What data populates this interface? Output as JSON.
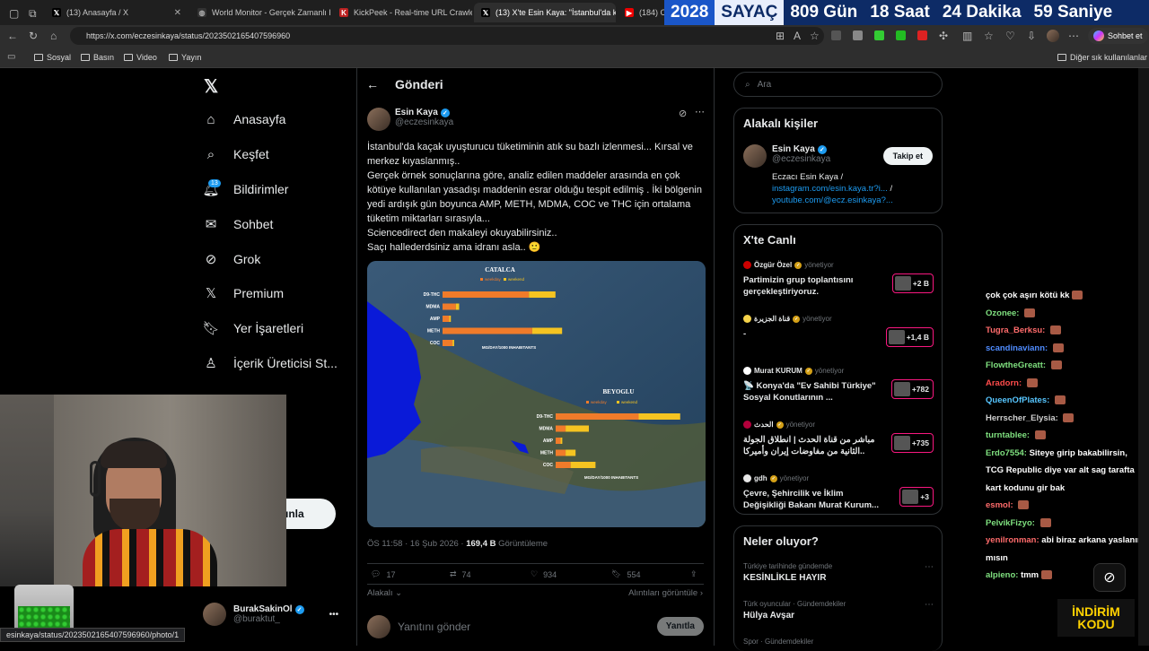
{
  "browser": {
    "tabs": [
      {
        "title": "(13) Anasayfa / X",
        "icon": "x-logo-icon"
      },
      {
        "title": "World Monitor - Gerçek Zamanlı K",
        "icon": "globe-icon"
      },
      {
        "title": "KickPeek - Real-time URL Crawler",
        "icon": "kickpeek-icon"
      },
      {
        "title": "(13) X'te Esin Kaya: \"İstanbul'da kaç",
        "icon": "x-logo-icon"
      },
      {
        "title": "(184) CH",
        "icon": "youtube-icon"
      }
    ],
    "active_tab": 3,
    "url": "https://x.com/eczesinkaya/status/2023502165407596960",
    "profile_button": "Sohbet et",
    "bookmarks": [
      "Sosyal",
      "Basın",
      "Video",
      "Yayın"
    ],
    "other_bookmarks": "Diğer sık kullanılanlar",
    "status_url": "esinkaya/status/2023502165407596960/photo/1"
  },
  "countdown": {
    "year": "2028",
    "label": "SAYAÇ",
    "days": "809 Gün",
    "hours": "18 Saat",
    "minutes": "24 Dakika",
    "seconds": "59 Saniye"
  },
  "sidebar": {
    "items": [
      {
        "label": "Anasayfa",
        "icon": "home-icon"
      },
      {
        "label": "Keşfet",
        "icon": "search-icon"
      },
      {
        "label": "Bildirimler",
        "icon": "bell-icon",
        "badge": "13"
      },
      {
        "label": "Sohbet",
        "icon": "mail-icon"
      },
      {
        "label": "Grok",
        "icon": "grok-icon"
      },
      {
        "label": "Premium",
        "icon": "x-premium-icon"
      },
      {
        "label": "Yer İşaretleri",
        "icon": "bookmark-icon"
      },
      {
        "label": "İçerik Üreticisi St...",
        "icon": "creator-icon"
      }
    ],
    "post_button_fragment": "ınla",
    "user": {
      "name": "BurakSakinOl",
      "handle": "@buraktut_"
    }
  },
  "post": {
    "header": "Gönderi",
    "author_name": "Esin Kaya",
    "author_handle": "@eczesinkaya",
    "text_lines": [
      "İstanbul'da kaçak uyuşturucu tüketiminin atık su bazlı izlenmesi... Kırsal ve merkez kıyaslanmış..",
      "Gerçek örnek sonuçlarına göre, analiz edilen maddeler arasında en çok kötüye kullanılan yasadışı maddenin esrar olduğu tespit edilmiş . İki bölgenin yedi ardışık gün boyunca AMP, METH, MDMA, COC ve THC için ortalama tüketim miktarları sırasıyla...",
      "Sciencedirect den makaleyi okuyabilirsiniz..",
      "Saçı hallederdsiniz ama idranı asla.. 🙂"
    ],
    "timestamp": "ÖS 11:58 · 16 Şub 2026 ·",
    "views": "169,4 B",
    "views_label": "Görüntüleme",
    "replies": "17",
    "reposts": "74",
    "likes": "934",
    "bookmarks": "554",
    "sort_label": "Alakalı",
    "quotes_label": "Alıntıları görüntüle",
    "reply_placeholder": "Yanıtını gönder",
    "reply_button": "Yanıtla"
  },
  "map_figure": {
    "region1": "CATALCA",
    "region2": "BEYOGLU",
    "legend_weekday": "weekday",
    "legend_weekend": "weekend",
    "unit_label": "MG/DAY/1000 INHABITANTS",
    "labels": [
      "D9-THC",
      "MDMA",
      "AMP",
      "METH",
      "COC"
    ],
    "region1_weekday": [
      52,
      8,
      4,
      54,
      6
    ],
    "region1_weekend": [
      68,
      10,
      5,
      72,
      7
    ],
    "region2_weekday": [
      50,
      6,
      3,
      6,
      9
    ],
    "region2_weekend": [
      75,
      20,
      4,
      12,
      24
    ]
  },
  "right": {
    "search_placeholder": "Ara",
    "related_title": "Alakalı kişiler",
    "related": {
      "name": "Esin Kaya",
      "handle": "@eczesinkaya",
      "follow": "Takip et",
      "bio1": "Eczacı Esin Kaya /",
      "link1": "instagram.com/esin.kaya.tr?i...",
      "sep": "/",
      "link2": "youtube.com/@ecz.esinkaya?..."
    },
    "live_title": "X'te Canlı",
    "live": [
      {
        "host": "Özgür Özel",
        "status": "yönetiyor",
        "title": "Partimizin grup toplantısını gerçekleştiriyoruz.",
        "count": "+2 B"
      },
      {
        "host": "قناة الجزيرة",
        "status": "yönetiyor",
        "title": "-",
        "count": "+1,4 B"
      },
      {
        "host": "Murat KURUM",
        "status": "yönetiyor",
        "title": "📡 Konya'da \"Ev Sahibi Türkiye\" Sosyal Konutlarının ...",
        "count": "+782"
      },
      {
        "host": "الحدث",
        "status": "yönetiyor",
        "title": "مباشر من قناة الحدث | انطلاق الجولة الثانية من مفاوضات إيران وأميركا..",
        "count": "+735"
      },
      {
        "host": "gdh",
        "status": "yönetiyor",
        "title": "Çevre, Şehircilik ve İklim Değişikliği Bakanı Murat Kurum...",
        "count": "+3"
      }
    ],
    "trends_title": "Neler oluyor?",
    "trends": [
      {
        "cat": "Türkiye tarihinde gündemde",
        "title": "KESİNLİKLE HAYIR"
      },
      {
        "cat": "Türk oyuncular · Gündemdekiler",
        "title": "Hülya Avşar"
      },
      {
        "cat": "Spor · Gündemdekiler",
        "title": ""
      }
    ]
  },
  "chat": [
    {
      "user": "",
      "msg": "çok çok aşırı kötü kk"
    },
    {
      "user": "Ozonee:",
      "msg": ""
    },
    {
      "user": "Tugra_Berksu:",
      "msg": ""
    },
    {
      "user": "scandinaviann:",
      "msg": ""
    },
    {
      "user": "FlowtheGreatt:",
      "msg": ""
    },
    {
      "user": "Aradorn:",
      "msg": ""
    },
    {
      "user": "QueenOfPlates:",
      "msg": ""
    },
    {
      "user": "Herrscher_Elysia:",
      "msg": ""
    },
    {
      "user": "turntablee:",
      "msg": ""
    },
    {
      "user": "Erdo7554:",
      "msg": "Siteye girip bakabilirsin, TCG Republic diye var alt sag tarafta kart kodunu gir bak"
    },
    {
      "user": "esmol:",
      "msg": ""
    },
    {
      "user": "PelvikFizyo:",
      "msg": ""
    },
    {
      "user": "yenilronman:",
      "msg": "abi biraz arkana yaslanır mısın"
    },
    {
      "user": "alpieno:",
      "msg": "tmm"
    }
  ],
  "overlay_logo": {
    "line1": "İNDİRİM",
    "line2": "KODU"
  },
  "colors": {
    "accent": "#1d9bf0",
    "bar_weekday": "#f07b2a",
    "bar_weekend": "#f5c421",
    "live_border": "#f91880"
  }
}
